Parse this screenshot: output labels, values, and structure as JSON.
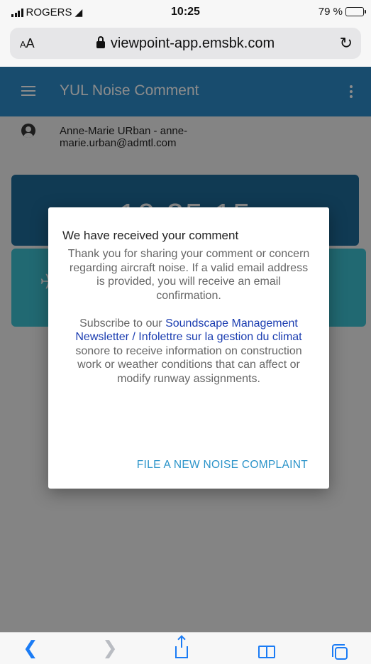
{
  "status_bar": {
    "carrier": "ROGERS",
    "time": "10:25",
    "battery": "79 %",
    "battery_level": 0.79
  },
  "browser": {
    "text_size_label": "AA",
    "url": "viewpoint-app.emsbk.com"
  },
  "app": {
    "title": "YUL Noise Comment",
    "user": "Anne-Marie URban - anne-marie.urban@admtl.com",
    "clock": "10:25:15",
    "colors": {
      "appbar": "#2d8bc9",
      "clock_card": "#1e6a97",
      "teal_card": "#3dbfd0",
      "action": "#2a93c9"
    }
  },
  "dialog": {
    "title": "We have received your comment",
    "body1": "Thank you for sharing your comment or concern regarding aircraft noise. If a valid email address is provided, you will receive an email confirmation.",
    "body2_prefix": "Subscribe to our ",
    "body2_link": "Soundscape Management Newsletter / Infolettre sur la gestion du climat",
    "body2_suffix": " sonore to receive information on construction work or weather conditions that can affect or modify runway assignments.",
    "action": "FILE A NEW NOISE COMPLAINT"
  },
  "toolbar": {
    "icons": [
      "back-icon",
      "forward-icon",
      "share-icon",
      "bookmarks-icon",
      "tabs-icon"
    ]
  }
}
